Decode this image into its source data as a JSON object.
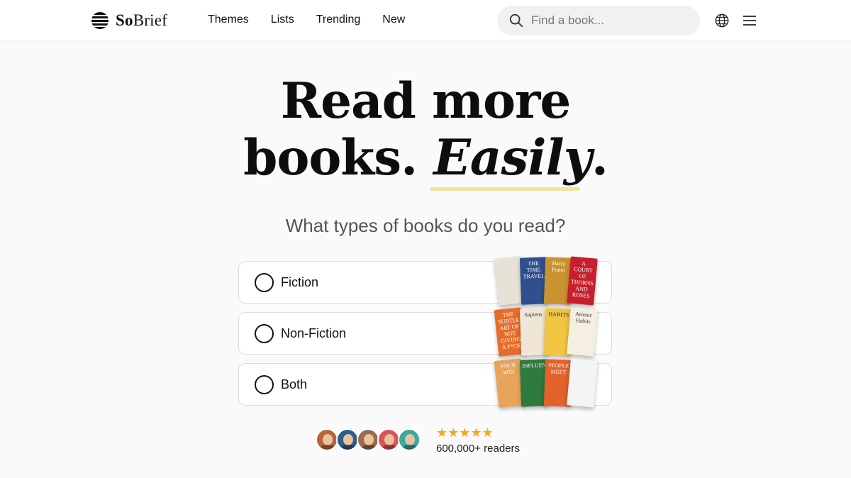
{
  "brand": {
    "name_bold": "So",
    "name_rest": "Brief"
  },
  "nav": {
    "items": [
      "Themes",
      "Lists",
      "Trending",
      "New"
    ]
  },
  "search": {
    "placeholder": "Find a book..."
  },
  "icons": {
    "search": "search-icon",
    "language": "globe-icon",
    "menu": "hamburger-menu-icon",
    "logo": "striped-circle-logo"
  },
  "hero": {
    "line1": "Read more",
    "line2_plain": "books.",
    "line2_emphasis": "Easily",
    "line2_end": ".",
    "question": "What types of books do you read?"
  },
  "options": [
    {
      "label": "Fiction",
      "covers": [
        {
          "title": "",
          "color": "#e8e2d6"
        },
        {
          "title": "THE TIME TRAVEL",
          "color": "#2f4f8f"
        },
        {
          "title": "Harry Potter",
          "color": "#c9932f"
        },
        {
          "title": "A COURT OF THORNS AND ROSES",
          "color": "#c81f2c"
        }
      ]
    },
    {
      "label": "Non-Fiction",
      "covers": [
        {
          "title": "THE SUBTLE ART OF NOT GIVING A F*CK",
          "color": "#e86b2a"
        },
        {
          "title": "Sapiens",
          "color": "#efe6d8"
        },
        {
          "title": "HABITS",
          "color": "#f1c441"
        },
        {
          "title": "Atomic Habits",
          "color": "#f5efe2"
        }
      ]
    },
    {
      "label": "Both",
      "covers": [
        {
          "title": "FOUR WIN",
          "color": "#e7a45a"
        },
        {
          "title": "INFLUENCE",
          "color": "#2f7a3f"
        },
        {
          "title": "PEOPLE MEET",
          "color": "#e2622a"
        },
        {
          "title": "",
          "color": "#f4f4f4"
        }
      ]
    }
  ],
  "social": {
    "stars": "★★★★★",
    "readers": "600,000+ readers",
    "avatar_colors": [
      "#b5653a",
      "#2e5f8a",
      "#9c6b4e",
      "#d9545a",
      "#3aa7a0"
    ],
    "star_color": "#f5a623"
  }
}
